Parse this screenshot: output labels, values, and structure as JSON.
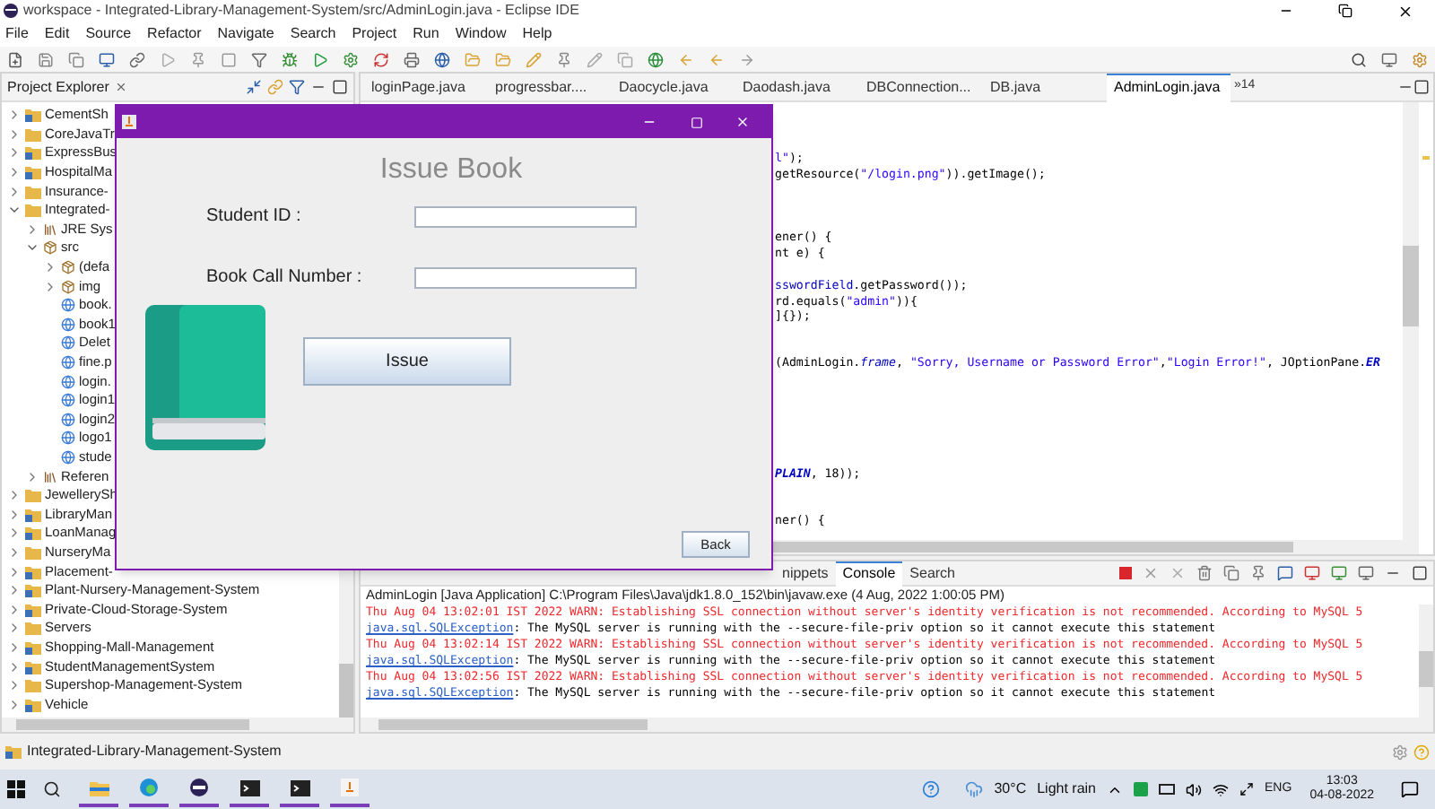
{
  "window": {
    "title": "workspace - Integrated-Library-Management-System/src/AdminLogin.java - Eclipse IDE"
  },
  "menu": [
    "File",
    "Edit",
    "Source",
    "Refactor",
    "Navigate",
    "Search",
    "Project",
    "Run",
    "Window",
    "Help"
  ],
  "project_explorer": {
    "title": "Project Explorer",
    "tree": [
      {
        "label": "CementSh",
        "kind": "project",
        "expanded": false
      },
      {
        "label": "CoreJavaTr",
        "kind": "folder",
        "expanded": false
      },
      {
        "label": "ExpressBus",
        "kind": "project",
        "expanded": false
      },
      {
        "label": "HospitalMa",
        "kind": "project",
        "expanded": false
      },
      {
        "label": "Insurance-",
        "kind": "folder",
        "expanded": false
      },
      {
        "label": "Integrated-",
        "kind": "folder",
        "expanded": true,
        "children": [
          {
            "label": "JRE Sys",
            "kind": "library",
            "expanded": false
          },
          {
            "label": "src",
            "kind": "source",
            "expanded": true,
            "children": [
              {
                "label": "(defa",
                "kind": "package",
                "expanded": false
              },
              {
                "label": "img",
                "kind": "package",
                "expanded": false
              },
              {
                "label": "book.",
                "kind": "file"
              },
              {
                "label": "book1",
                "kind": "file"
              },
              {
                "label": "Delet",
                "kind": "file"
              },
              {
                "label": "fine.p",
                "kind": "file"
              },
              {
                "label": "login.",
                "kind": "file"
              },
              {
                "label": "login1",
                "kind": "file"
              },
              {
                "label": "login2",
                "kind": "file"
              },
              {
                "label": "logo1",
                "kind": "file"
              },
              {
                "label": "stude",
                "kind": "file"
              }
            ]
          },
          {
            "label": "Referen",
            "kind": "library",
            "expanded": false
          }
        ]
      },
      {
        "label": "JewellerySh",
        "kind": "folder",
        "expanded": false
      },
      {
        "label": "LibraryMan",
        "kind": "project",
        "expanded": false
      },
      {
        "label": "LoanManag",
        "kind": "project",
        "expanded": false
      },
      {
        "label": "NurseryMa",
        "kind": "folder",
        "expanded": false
      },
      {
        "label": "Placement-",
        "kind": "project",
        "expanded": false
      },
      {
        "label": "Plant-Nursery-Management-System",
        "kind": "project",
        "expanded": false
      },
      {
        "label": "Private-Cloud-Storage-System",
        "kind": "project",
        "expanded": false
      },
      {
        "label": "Servers",
        "kind": "folder",
        "expanded": false
      },
      {
        "label": "Shopping-Mall-Management",
        "kind": "project",
        "expanded": false
      },
      {
        "label": "StudentManagementSystem",
        "kind": "project",
        "expanded": false
      },
      {
        "label": "Supershop-Management-System",
        "kind": "folder",
        "expanded": false
      },
      {
        "label": "Vehicle",
        "kind": "project",
        "expanded": false
      }
    ]
  },
  "editor": {
    "tabs": [
      {
        "label": "loginPage.java",
        "selected": false
      },
      {
        "label": "progressbar....",
        "selected": false
      },
      {
        "label": "Daocycle.java",
        "selected": false
      },
      {
        "label": "Daodash.java",
        "selected": false
      },
      {
        "label": "DBConnection...",
        "selected": false
      },
      {
        "label": "DB.java",
        "selected": false
      },
      {
        "label": "AdminLogin.java",
        "selected": true
      }
    ],
    "overflow": "»14",
    "code_blocks": [
      {
        "lines": [
          {
            "segments": [
              {
                "kind": "string",
                "text": "l\""
              },
              {
                "kind": "plain",
                "text": ");"
              }
            ]
          },
          {
            "segments": [
              {
                "kind": "plain",
                "text": "getResource("
              },
              {
                "kind": "string",
                "text": "\"/login.png\""
              },
              {
                "kind": "plain",
                "text": ")).getImage();"
              }
            ]
          }
        ]
      },
      {
        "lines": [
          {
            "segments": [
              {
                "kind": "plain",
                "text": "ener() {"
              }
            ]
          },
          {
            "segments": [
              {
                "kind": "plain",
                "text": "nt e) {"
              }
            ]
          }
        ]
      },
      {
        "lines": [
          {
            "segments": [
              {
                "kind": "field",
                "text": "sswordField"
              },
              {
                "kind": "plain",
                "text": ".getPassword());"
              }
            ]
          },
          {
            "segments": [
              {
                "kind": "plain",
                "text": "rd.equals("
              },
              {
                "kind": "string",
                "text": "\"admin\""
              },
              {
                "kind": "plain",
                "text": ")){"
              }
            ]
          },
          {
            "segments": [
              {
                "kind": "plain",
                "text": "]{});"
              }
            ]
          }
        ]
      },
      {
        "lines": [
          {
            "segments": [
              {
                "kind": "plain",
                "text": "(AdminLogin."
              },
              {
                "kind": "static",
                "text": "frame"
              },
              {
                "kind": "plain",
                "text": ", "
              },
              {
                "kind": "string",
                "text": "\"Sorry, Username or Password Error\""
              },
              {
                "kind": "plain",
                "text": ","
              },
              {
                "kind": "string",
                "text": "\"Login Error!\""
              },
              {
                "kind": "plain",
                "text": ", JOptionPane."
              },
              {
                "kind": "constant",
                "text": "ER"
              }
            ]
          }
        ]
      },
      {
        "lines": [
          {
            "segments": [
              {
                "kind": "constant",
                "text": "PLAIN"
              },
              {
                "kind": "plain",
                "text": ", 18));"
              }
            ]
          }
        ]
      },
      {
        "lines": [
          {
            "segments": [
              {
                "kind": "plain",
                "text": "ner() {"
              }
            ]
          }
        ]
      }
    ]
  },
  "console_panel": {
    "tabs": [
      {
        "label": "nippets",
        "selected": false
      },
      {
        "label": "Console",
        "selected": true
      },
      {
        "label": "Search",
        "selected": false
      }
    ],
    "header": "AdminLogin [Java Application] C:\\Program Files\\Java\\jdk1.8.0_152\\bin\\javaw.exe  (4 Aug, 2022 1:00:05 PM)",
    "lines": [
      {
        "kind": "warn",
        "text": "Thu Aug 04 13:02:01 IST 2022 WARN: Establishing SSL connection without server's identity verification is not recommended. According to MySQL 5"
      },
      {
        "kind": "exception",
        "link": "java.sql.SQLException",
        "text": ": The MySQL server is running with the --secure-file-priv option so it cannot execute this statement"
      },
      {
        "kind": "warn",
        "text": "Thu Aug 04 13:02:14 IST 2022 WARN: Establishing SSL connection without server's identity verification is not recommended. According to MySQL 5"
      },
      {
        "kind": "exception",
        "link": "java.sql.SQLException",
        "text": ": The MySQL server is running with the --secure-file-priv option so it cannot execute this statement"
      },
      {
        "kind": "warn",
        "text": "Thu Aug 04 13:02:56 IST 2022 WARN: Establishing SSL connection without server's identity verification is not recommended. According to MySQL 5"
      },
      {
        "kind": "exception",
        "link": "java.sql.SQLException",
        "text": ": The MySQL server is running with the --secure-file-priv option so it cannot execute this statement"
      }
    ]
  },
  "status_bar": {
    "text": "Integrated-Library-Management-System"
  },
  "dialog": {
    "heading": "Issue Book",
    "fields": [
      {
        "label": "Student ID :"
      },
      {
        "label": "Book Call Number :"
      }
    ],
    "issue_button": "Issue",
    "back_button": "Back"
  },
  "taskbar": {
    "apps": [
      {
        "kind": "files",
        "running": true
      },
      {
        "kind": "browser",
        "running": true
      },
      {
        "kind": "eclipse",
        "running": true
      },
      {
        "kind": "terminal",
        "running": true
      },
      {
        "kind": "terminal",
        "running": true
      },
      {
        "kind": "java",
        "running": true
      }
    ],
    "temperature": "30°C",
    "weather": "Light rain",
    "language": "ENG",
    "time": "13:03",
    "date": "04-08-2022"
  }
}
